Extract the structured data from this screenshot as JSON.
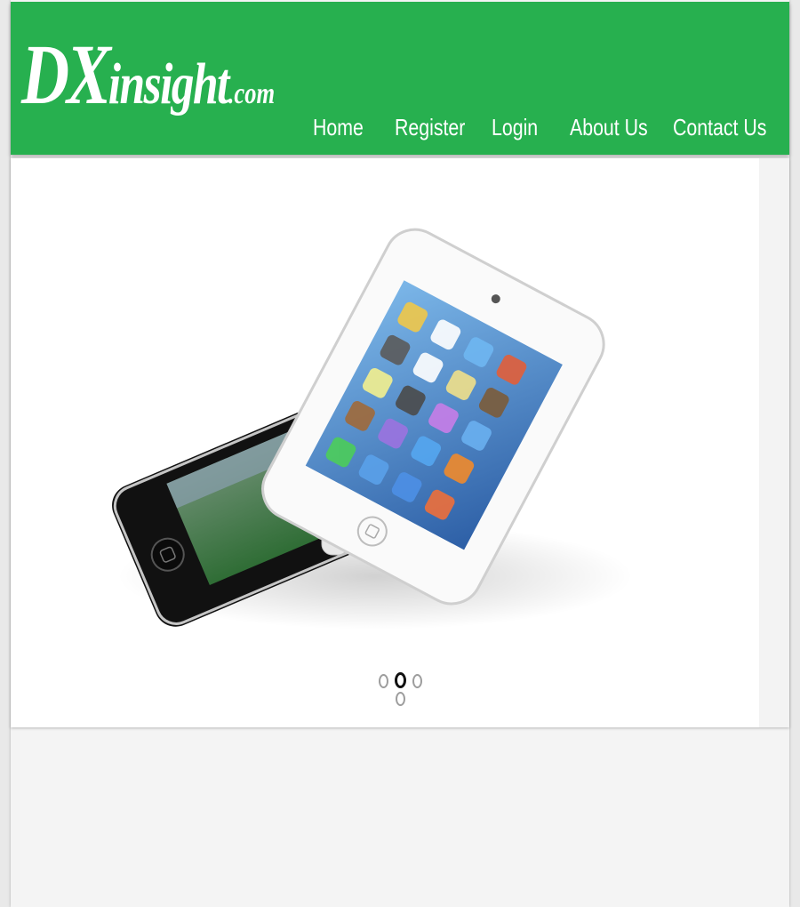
{
  "site": {
    "logo_big": "DX",
    "logo_mid": "insight",
    "logo_small": ".com"
  },
  "nav": {
    "items": [
      "Home",
      "Register",
      "Login",
      "About Us",
      "Contact Us"
    ]
  },
  "slider": {
    "active_slide_index": 1,
    "slide_count": 4
  },
  "colors": {
    "header_green": "#27b04f",
    "white": "#ffffff",
    "active_dot": "#111111",
    "inactive_dot": "#9d9d9d"
  }
}
